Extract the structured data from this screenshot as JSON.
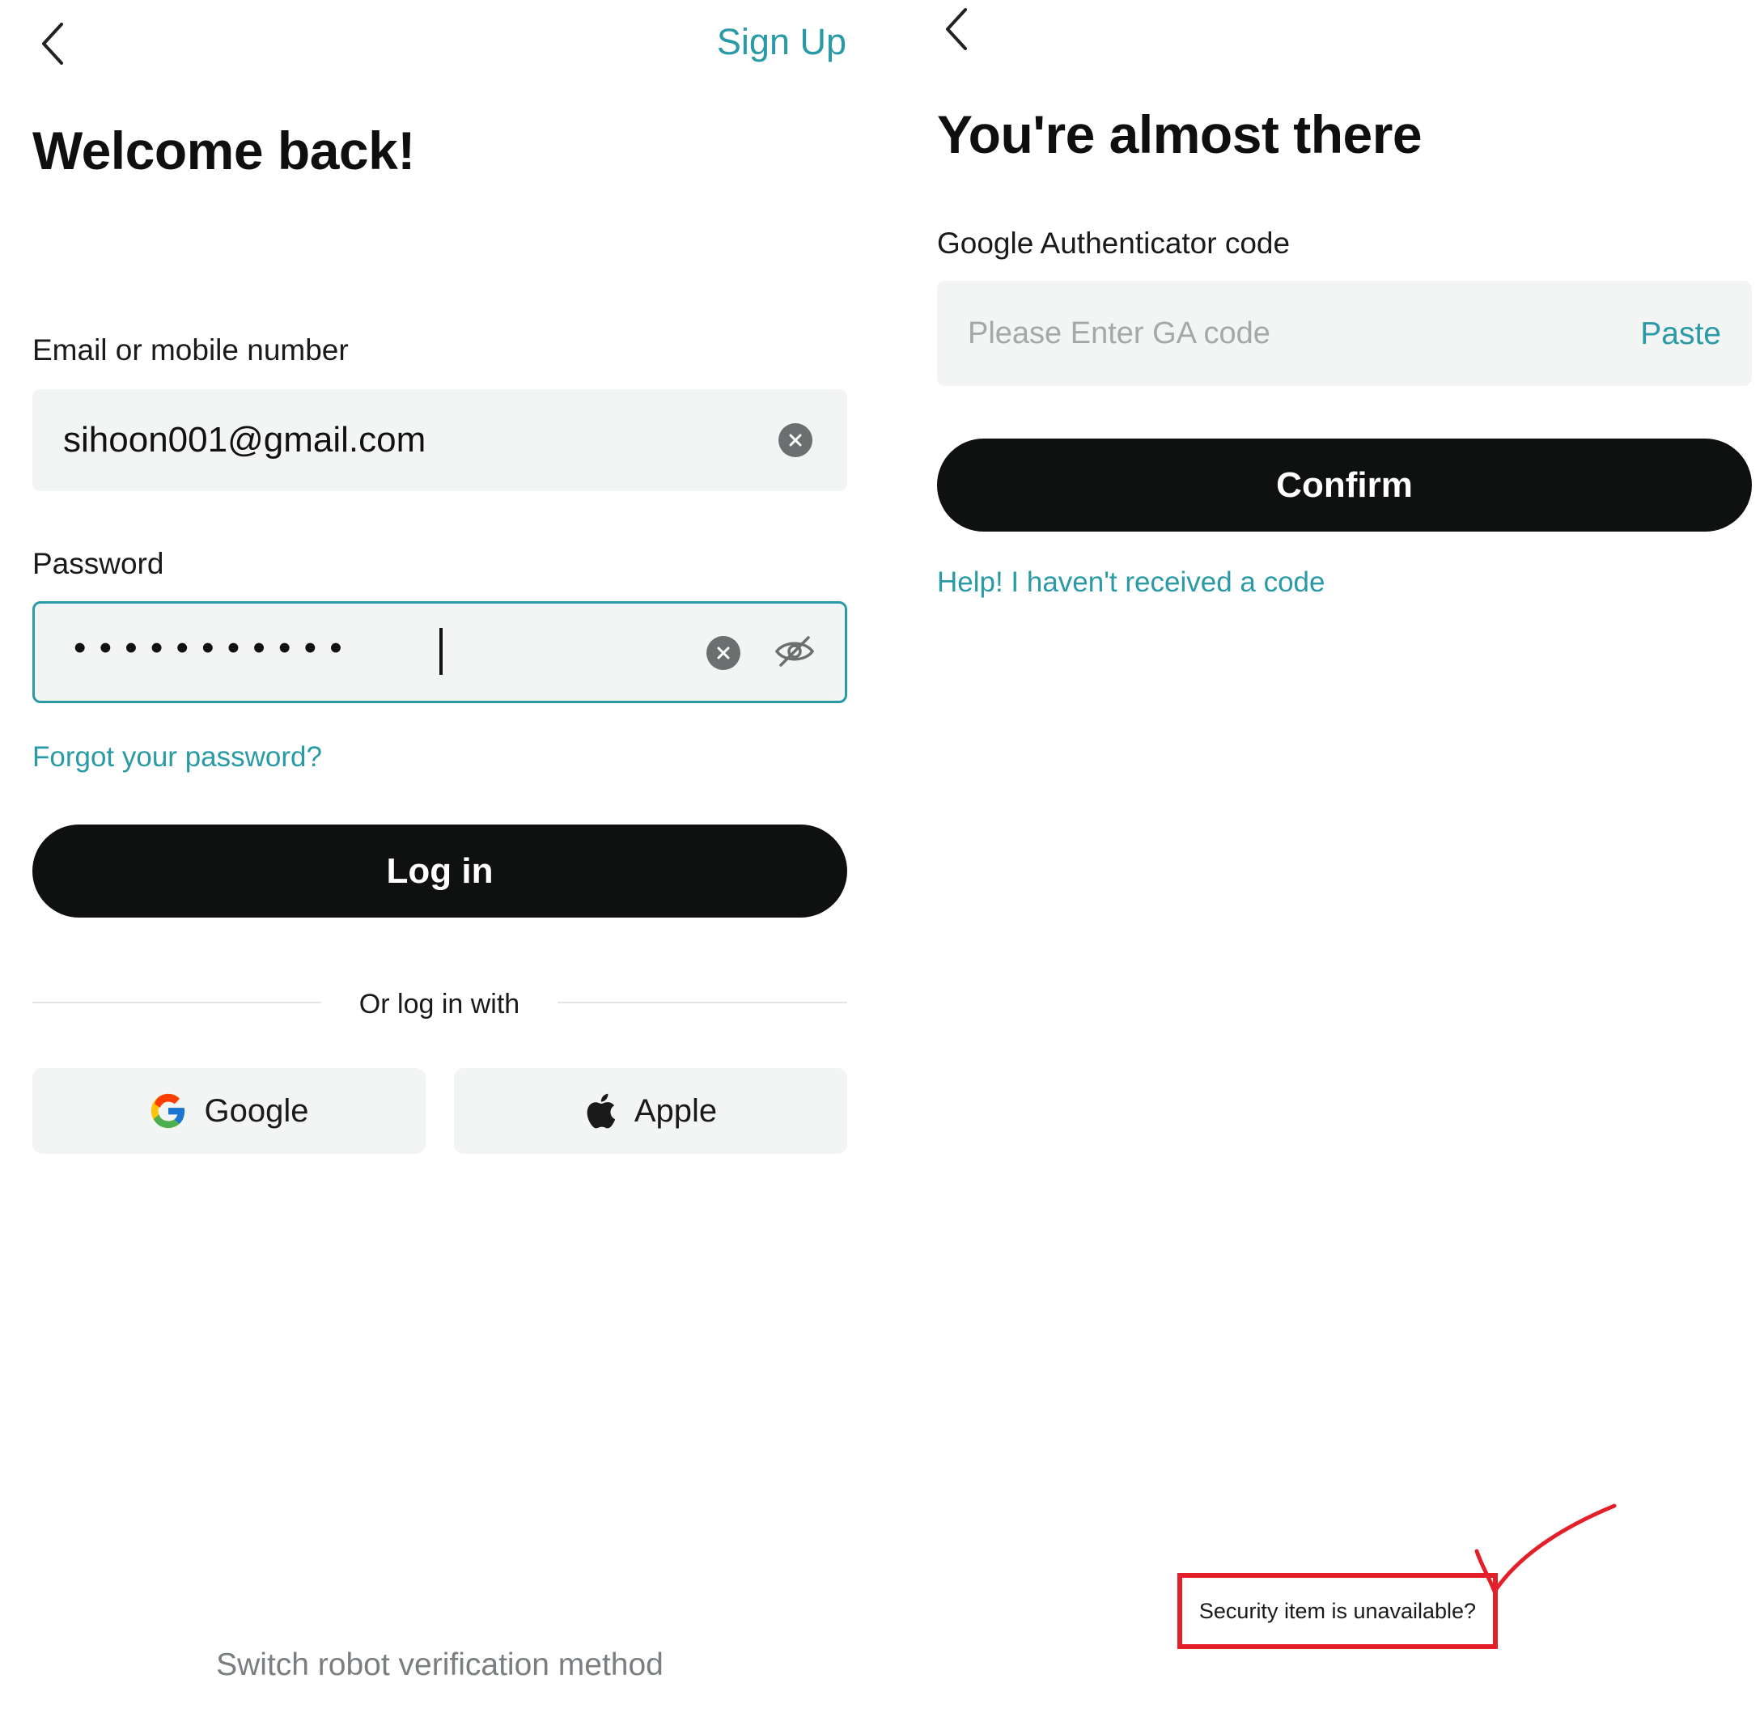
{
  "left_screen": {
    "signup_link": "Sign Up",
    "title": "Welcome back!",
    "email_label": "Email or mobile number",
    "email_value": "sihoon001@gmail.com",
    "password_label": "Password",
    "password_mask": "• • • • • • • • • • •",
    "forgot_link": "Forgot your password?",
    "login_button": "Log in",
    "divider_text": "Or log in with",
    "google_button": "Google",
    "apple_button": "Apple",
    "switch_link": "Switch robot verification method"
  },
  "right_screen": {
    "title": "You're almost there",
    "ga_label": "Google Authenticator code",
    "ga_placeholder": "Please Enter GA code",
    "paste_button": "Paste",
    "confirm_button": "Confirm",
    "help_link": "Help! I haven't received a code",
    "security_link": "Security item is unavailable?"
  },
  "colors": {
    "accent": "#2a9aa6",
    "button": "#0f1111",
    "field_bg": "#f3f4f4",
    "annotation": "#e3202a"
  },
  "icons": [
    "back-chevron-icon",
    "clear-icon",
    "eye-off-icon",
    "google-logo-icon",
    "apple-logo-icon",
    "checkmark-annotation-icon"
  ]
}
